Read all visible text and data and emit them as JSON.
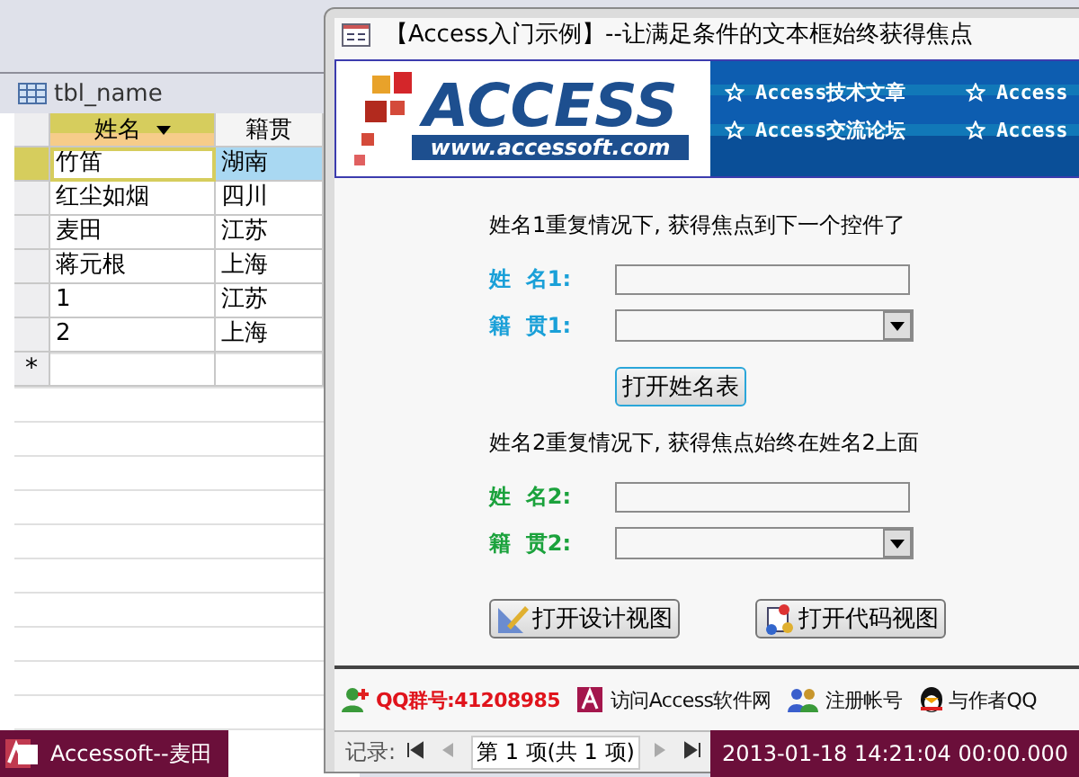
{
  "table": {
    "title": "tbl_name",
    "columns": [
      {
        "label": "姓名",
        "selected": true
      },
      {
        "label": "籍贯",
        "selected": false
      }
    ],
    "rows": [
      {
        "cells": [
          "竹笛",
          "湖南"
        ],
        "selected": true
      },
      {
        "cells": [
          "红尘如烟",
          "四川"
        ],
        "selected": false
      },
      {
        "cells": [
          "麦田",
          "江苏"
        ],
        "selected": false
      },
      {
        "cells": [
          "蒋元根",
          "上海"
        ],
        "selected": false
      },
      {
        "cells": [
          "1",
          "江苏"
        ],
        "selected": false
      },
      {
        "cells": [
          "2",
          "上海"
        ],
        "selected": false
      }
    ],
    "new_row_mark": "*"
  },
  "form": {
    "title": "【Access入门示例】--让满足条件的文本框始终获得焦点",
    "banner": {
      "logo": "ACCESS",
      "url": "www.accessoft.com",
      "links": [
        [
          "Access技术文章",
          "Access"
        ],
        [
          "Access交流论坛",
          "Access"
        ]
      ]
    },
    "sections": [
      {
        "heading": "姓名1重复情况下, 获得焦点到下一个控件了",
        "color": "#1aa0d8",
        "fields": [
          {
            "label": "姓  名1:",
            "kind": "text"
          },
          {
            "label": "籍  贯1:",
            "kind": "combo"
          }
        ],
        "button": "打开姓名表"
      },
      {
        "heading": "姓名2重复情况下, 获得焦点始终在姓名2上面",
        "color": "#1ba23c",
        "fields": [
          {
            "label": "姓  名2:",
            "kind": "text"
          },
          {
            "label": "籍  贯2:",
            "kind": "combo"
          }
        ]
      }
    ],
    "view_buttons": [
      "打开设计视图",
      "打开代码视图"
    ],
    "footer_links": [
      {
        "text": "QQ群号:41208985",
        "kind": "qq"
      },
      {
        "text": "访问Access软件网",
        "kind": "access"
      },
      {
        "text": "注册帐号",
        "kind": "users"
      },
      {
        "text": "与作者QQ",
        "kind": "penguin"
      }
    ],
    "record_nav": {
      "label": "记录:",
      "position": "第 1 项(共 1 项)"
    }
  },
  "taskbar": {
    "app": "Accessoft--麦田",
    "clock": "2013-01-18 14:21:04 00:00.000"
  }
}
